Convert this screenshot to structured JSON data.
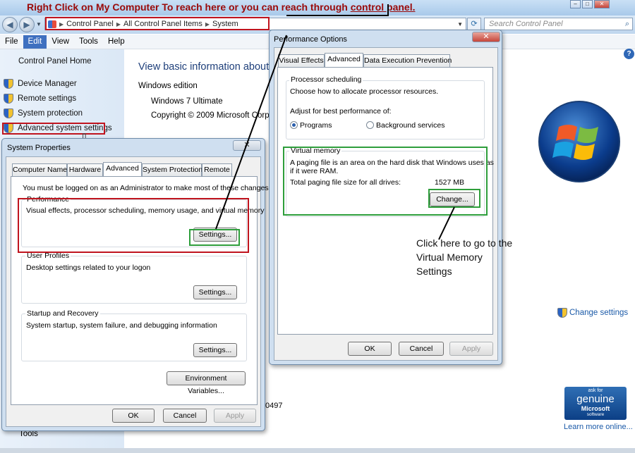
{
  "annotation_top": {
    "prefix": "Right Click on My Computer To reach here or you can reach through ",
    "link": "control panel."
  },
  "address_bar": {
    "crumbs": [
      "Control Panel",
      "All Control Panel Items",
      "System"
    ]
  },
  "search": {
    "placeholder": "Search Control Panel"
  },
  "menu": [
    "File",
    "Edit",
    "View",
    "Tools",
    "Help"
  ],
  "left_pane": {
    "home": "Control Panel Home",
    "links": [
      "Device Manager",
      "Remote settings",
      "System protection",
      "Advanced system settings"
    ],
    "tools": "Tools"
  },
  "main": {
    "heading": "View basic information about",
    "edition_label": "Windows edition",
    "version": "Windows 7 Ultimate",
    "copyright": "Copyright © 2009 Microsoft Corpor",
    "change_settings": "Change settings",
    "partial_number": "0497",
    "learn_more": "Learn more online...",
    "genuine": {
      "ask": "ask for",
      "genuine": "genuine",
      "microsoft": "Microsoft",
      "software": "software"
    }
  },
  "system_properties": {
    "title": "System Properties",
    "tabs": [
      "Computer Name",
      "Hardware",
      "Advanced",
      "System Protection",
      "Remote"
    ],
    "admin_note": "You must be logged on as an Administrator to make most of these changes.",
    "performance": {
      "title": "Performance",
      "desc": "Visual effects, processor scheduling, memory usage, and virtual memory",
      "button": "Settings..."
    },
    "user_profiles": {
      "title": "User Profiles",
      "desc": "Desktop settings related to your logon",
      "button": "Settings..."
    },
    "startup": {
      "title": "Startup and Recovery",
      "desc": "System startup, system failure, and debugging information",
      "button": "Settings..."
    },
    "env_button": "Environment Variables...",
    "ok": "OK",
    "cancel": "Cancel",
    "apply": "Apply"
  },
  "performance_options": {
    "title": "Performance Options",
    "tabs": [
      "Visual Effects",
      "Advanced",
      "Data Execution Prevention"
    ],
    "scheduling": {
      "title": "Processor scheduling",
      "desc": "Choose how to allocate processor resources.",
      "adjust": "Adjust for best performance of:",
      "programs": "Programs",
      "background": "Background services"
    },
    "virtual_memory": {
      "title": "Virtual memory",
      "desc1": "A paging file is an area on the hard disk that Windows uses as",
      "desc2": "if it were RAM.",
      "total_label": "Total paging file size for all drives:",
      "total_value": "1527 MB",
      "button": "Change..."
    },
    "ok": "OK",
    "cancel": "Cancel",
    "apply": "Apply"
  },
  "callout": [
    "Click here to go to the",
    "Virtual Memory",
    "Settings"
  ],
  "colors": {
    "annotation_red": "#9a0a0a",
    "highlight_red": "#c0141e",
    "highlight_green": "#2e9e3b",
    "link_blue": "#1b5aa8"
  }
}
